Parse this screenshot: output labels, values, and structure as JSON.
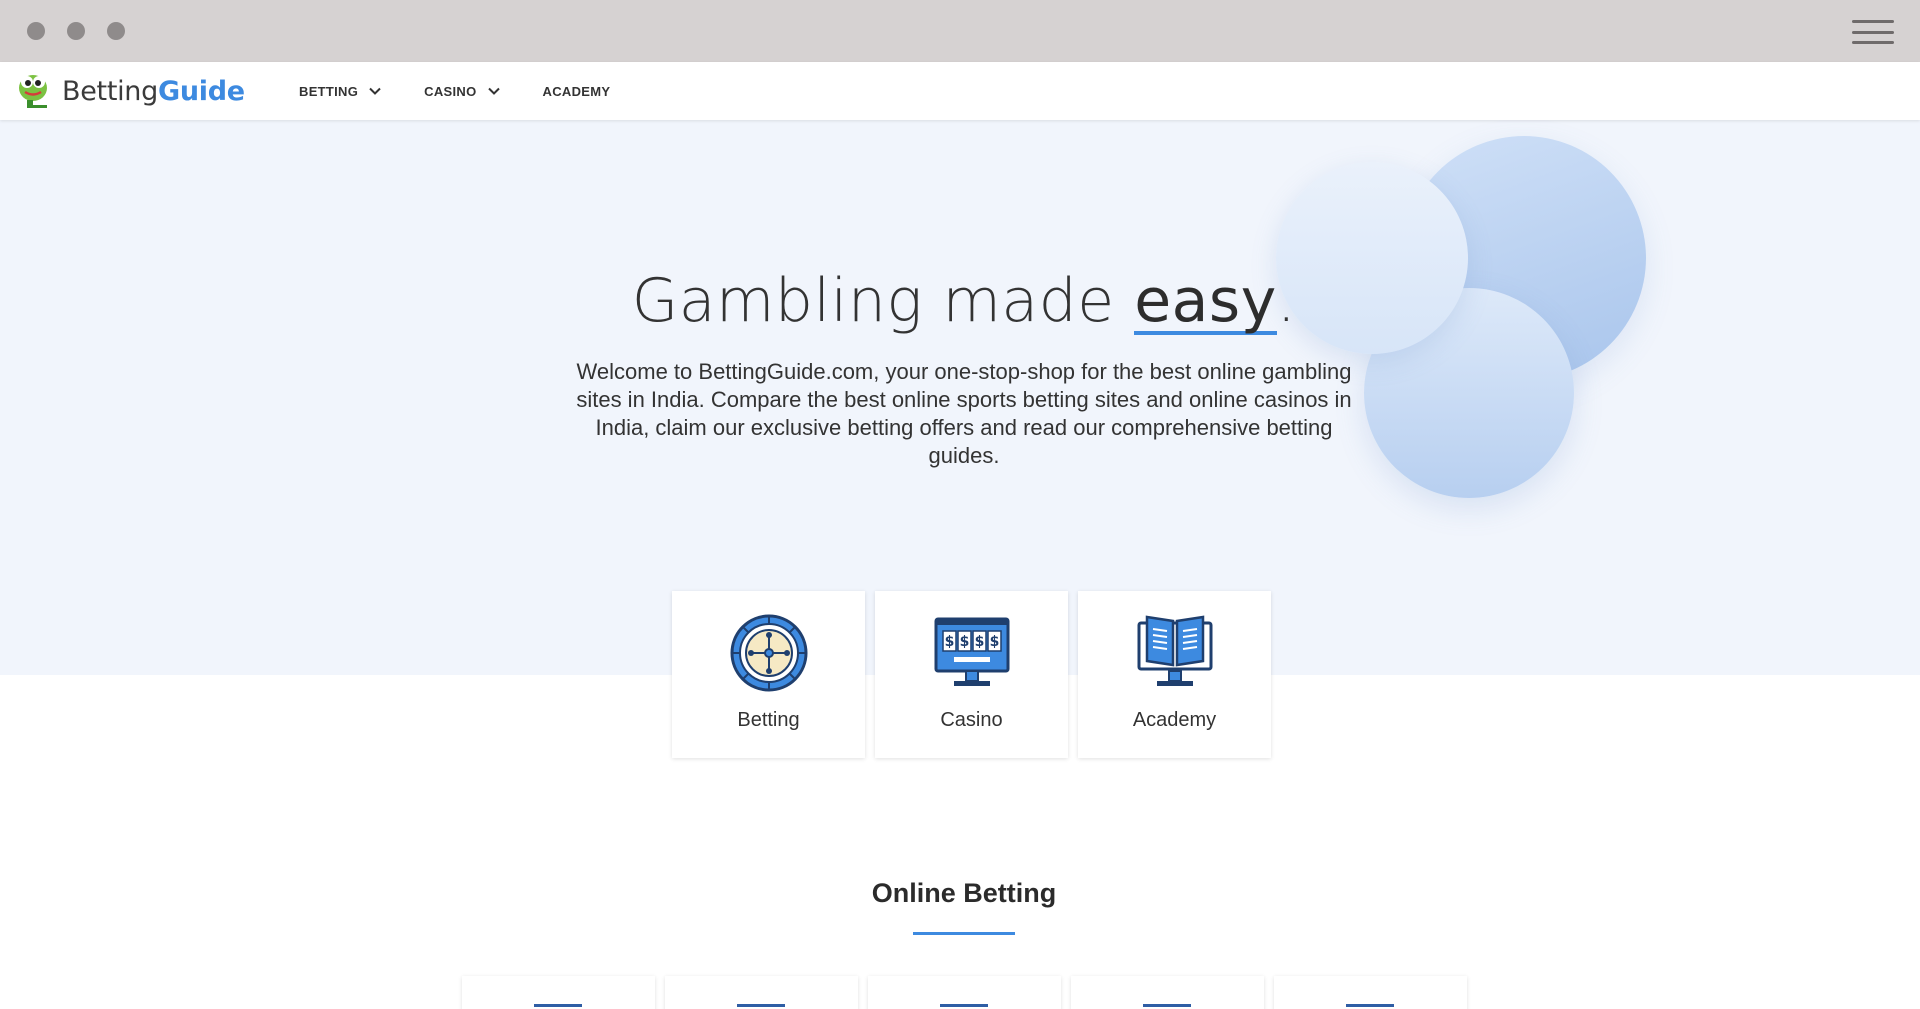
{
  "colors": {
    "accent": "#3d8ae0",
    "hero_background": "#f1f5fc",
    "chrome": "#d6d2d2"
  },
  "logo": {
    "part1": "Betting",
    "part2": "Guide",
    "icon": "frog-mascot-icon"
  },
  "nav": {
    "items": [
      {
        "label": "BETTING",
        "has_dropdown": true
      },
      {
        "label": "CASINO",
        "has_dropdown": true
      },
      {
        "label": "ACADEMY",
        "has_dropdown": false
      }
    ]
  },
  "hero": {
    "title_start": "Gambling made ",
    "title_emphasis": "easy",
    "title_end": ".",
    "description": "Welcome to BettingGuide.com, your one-stop-shop for the best online gambling sites in India. Compare the best online sports betting sites and online casinos in India, claim our exclusive betting offers and read our comprehensive betting guides."
  },
  "categories": [
    {
      "label": "Betting",
      "icon": "roulette-wheel-icon"
    },
    {
      "label": "Casino",
      "icon": "slot-machine-monitor-icon"
    },
    {
      "label": "Academy",
      "icon": "book-monitor-icon"
    }
  ],
  "section": {
    "title": "Online Betting"
  }
}
